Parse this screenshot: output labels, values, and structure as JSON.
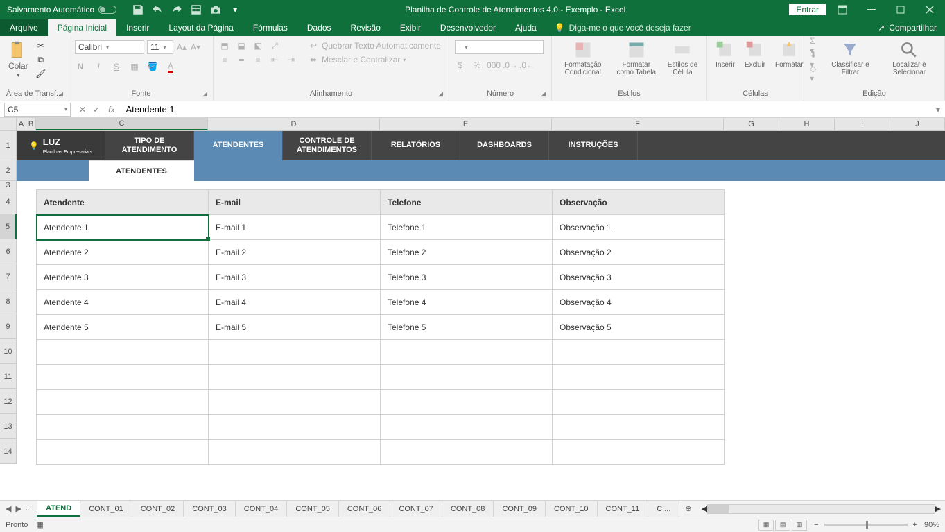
{
  "titlebar": {
    "autosave": "Salvamento Automático",
    "title": "Planilha de Controle de Atendimentos 4.0 - Exemplo  -  Excel",
    "enter": "Entrar"
  },
  "tabs": {
    "file": "Arquivo",
    "home": "Página Inicial",
    "insert": "Inserir",
    "layout": "Layout da Página",
    "formulas": "Fórmulas",
    "data": "Dados",
    "review": "Revisão",
    "view": "Exibir",
    "developer": "Desenvolvedor",
    "help": "Ajuda",
    "tellme": "Diga-me o que você deseja fazer",
    "share": "Compartilhar"
  },
  "ribbon": {
    "clipboard": {
      "paste": "Colar",
      "label": "Área de Transf..."
    },
    "font": {
      "name": "Calibri",
      "size": "11",
      "label": "Fonte"
    },
    "alignment": {
      "wrap": "Quebrar Texto Automaticamente",
      "merge": "Mesclar e Centralizar",
      "label": "Alinhamento"
    },
    "number": {
      "label": "Número"
    },
    "styles": {
      "cond": "Formatação Condicional",
      "table": "Formatar como Tabela",
      "cell": "Estilos de Célula",
      "label": "Estilos"
    },
    "cells": {
      "insert": "Inserir",
      "delete": "Excluir",
      "format": "Formatar",
      "label": "Células"
    },
    "editing": {
      "sort": "Classificar e Filtrar",
      "find": "Localizar e Selecionar",
      "label": "Edição"
    }
  },
  "formula": {
    "namebox": "C5",
    "value": "Atendente 1"
  },
  "columns": [
    "A",
    "B",
    "C",
    "D",
    "E",
    "F",
    "G",
    "H",
    "I",
    "J"
  ],
  "rows": [
    "1",
    "2",
    "3",
    "4",
    "5",
    "6",
    "7",
    "8",
    "9",
    "10",
    "11",
    "12",
    "13",
    "14"
  ],
  "template": {
    "logo": "LUZ",
    "logo_sub": "Planilhas Empresariais",
    "nav": [
      "TIPO DE ATENDIMENTO",
      "ATENDENTES",
      "CONTROLE DE ATENDIMENTOS",
      "RELATÓRIOS",
      "DASHBOARDS",
      "INSTRUÇÕES"
    ],
    "active_nav": 1,
    "subtab": "ATENDENTES"
  },
  "table": {
    "headers": [
      "Atendente",
      "E-mail",
      "Telefone",
      "Observação"
    ],
    "rows": [
      [
        "Atendente 1",
        "E-mail 1",
        "Telefone 1",
        "Observação 1"
      ],
      [
        "Atendente 2",
        "E-mail 2",
        "Telefone 2",
        "Observação 2"
      ],
      [
        "Atendente 3",
        "E-mail 3",
        "Telefone 3",
        "Observação 3"
      ],
      [
        "Atendente 4",
        "E-mail 4",
        "Telefone 4",
        "Observação 4"
      ],
      [
        "Atendente 5",
        "E-mail 5",
        "Telefone 5",
        "Observação 5"
      ]
    ]
  },
  "sheets": {
    "active": "ATEND",
    "list": [
      "ATEND",
      "CONT_01",
      "CONT_02",
      "CONT_03",
      "CONT_04",
      "CONT_05",
      "CONT_06",
      "CONT_07",
      "CONT_08",
      "CONT_09",
      "CONT_10",
      "CONT_11"
    ],
    "more": "C",
    "ellipsis": "..."
  },
  "status": {
    "ready": "Pronto",
    "zoom": "90%"
  }
}
